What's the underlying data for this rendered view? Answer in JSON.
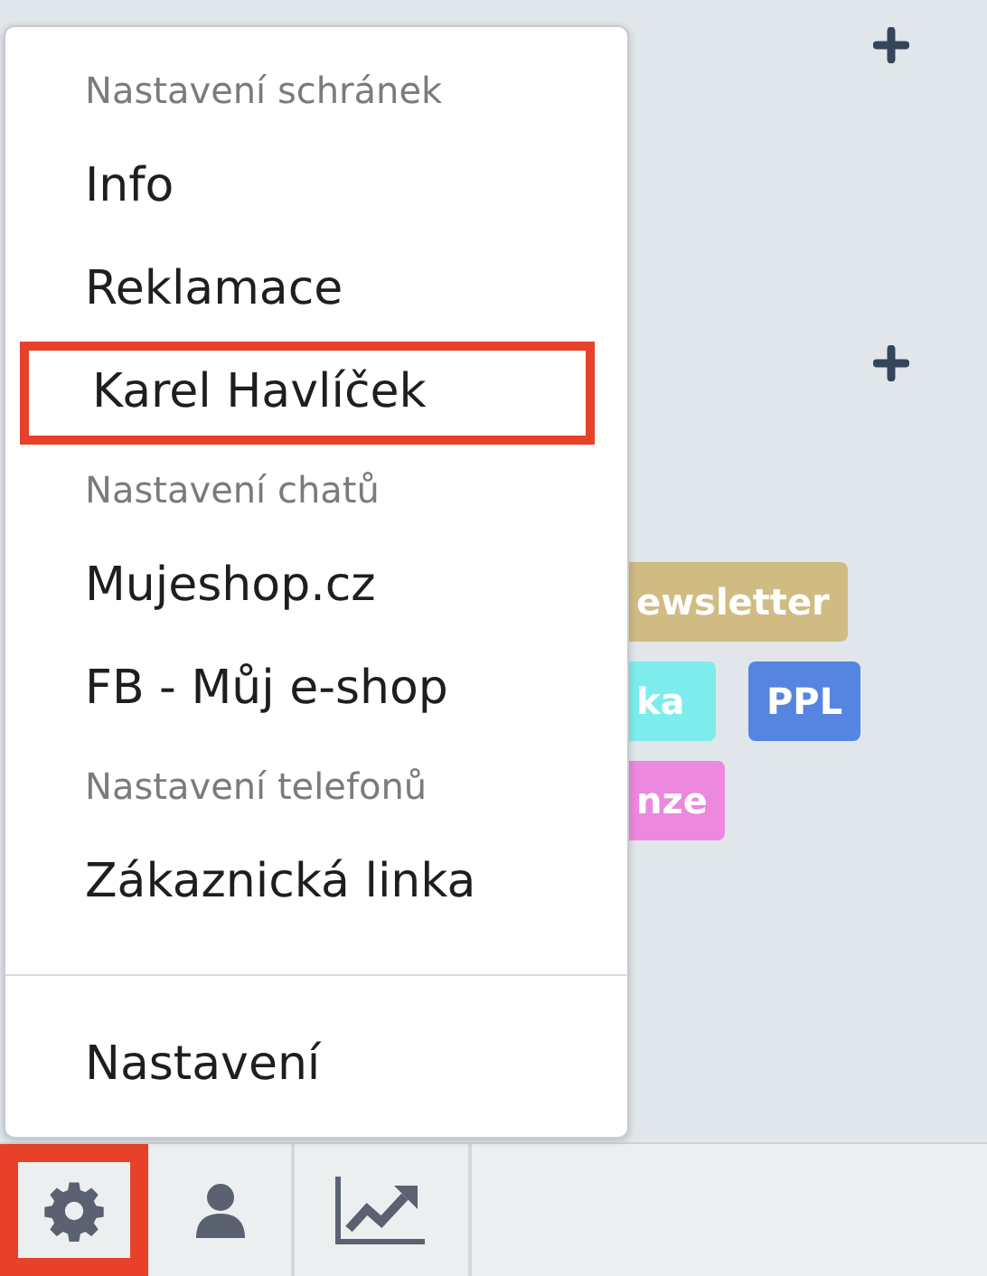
{
  "background": {
    "tag_rows": [
      [
        {
          "label": "ewsletter",
          "color": "#d0bc83"
        }
      ],
      [
        {
          "label": "ka",
          "color": "#7eeced"
        },
        {
          "label": "PPL",
          "color": "#5585e0"
        }
      ],
      [
        {
          "label": "nze",
          "color": "#ec88de"
        }
      ]
    ]
  },
  "menu": {
    "items": [
      {
        "kind": "header",
        "label": "Nastavení schránek"
      },
      {
        "kind": "item",
        "label": "Info",
        "highlighted": false
      },
      {
        "kind": "item",
        "label": "Reklamace",
        "highlighted": false
      },
      {
        "kind": "item",
        "label": "Karel Havlíček",
        "highlighted": true
      },
      {
        "kind": "header",
        "label": "Nastavení chatů"
      },
      {
        "kind": "item",
        "label": "Mujeshop.cz",
        "highlighted": false
      },
      {
        "kind": "item",
        "label": "FB - Můj e-shop",
        "highlighted": false
      },
      {
        "kind": "header",
        "label": "Nastavení telefonů"
      },
      {
        "kind": "item",
        "label": "Zákaznická linka",
        "highlighted": false
      },
      {
        "kind": "divider"
      },
      {
        "kind": "item",
        "label": "Nastavení",
        "highlighted": false
      }
    ]
  },
  "toolbar": [
    {
      "highlighted": true
    },
    {
      "highlighted": false
    },
    {
      "highlighted": false
    }
  ]
}
